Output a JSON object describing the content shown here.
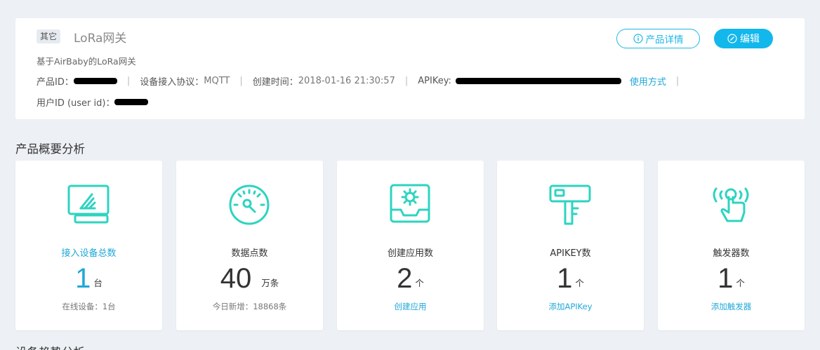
{
  "product": {
    "tag": "其它",
    "name": "LoRa网关",
    "description": "基于AirBaby的LoRa网关",
    "detail_button": "产品详情",
    "edit_button": "编辑",
    "info": {
      "product_id_label": "产品ID：",
      "protocol_label": "设备接入协议：",
      "protocol_value": "MQTT",
      "created_label": "创建时间：",
      "created_value": "2018-01-16 21:30:57",
      "apikey_label": "APIKey:",
      "usage_link": "使用方式",
      "user_id_label": "用户ID (user id)："
    }
  },
  "overview": {
    "title": "产品概要分析",
    "cards": [
      {
        "icon": "monitor-icon",
        "label": "接入设备总数",
        "value": "1",
        "unit": "台",
        "footer": "在线设备：1台"
      },
      {
        "icon": "gauge-icon",
        "label": "数据点数",
        "value": "40",
        "unit": "万条",
        "footer": "今日新增：18868条"
      },
      {
        "icon": "app-gear-icon",
        "label": "创建应用数",
        "value": "2",
        "unit": "个",
        "footer": "创建应用"
      },
      {
        "icon": "key-icon",
        "label": "APIKEY数",
        "value": "1",
        "unit": "个",
        "footer": "添加APIKey"
      },
      {
        "icon": "touch-trigger-icon",
        "label": "触发器数",
        "value": "1",
        "unit": "个",
        "footer": "添加触发器"
      }
    ]
  },
  "next_section": {
    "title": "设备趋势分析"
  },
  "colors": {
    "accent": "#12b7ec",
    "icon": "#2dd4c0",
    "link": "#20a8d8",
    "background": "#edf0f5"
  }
}
